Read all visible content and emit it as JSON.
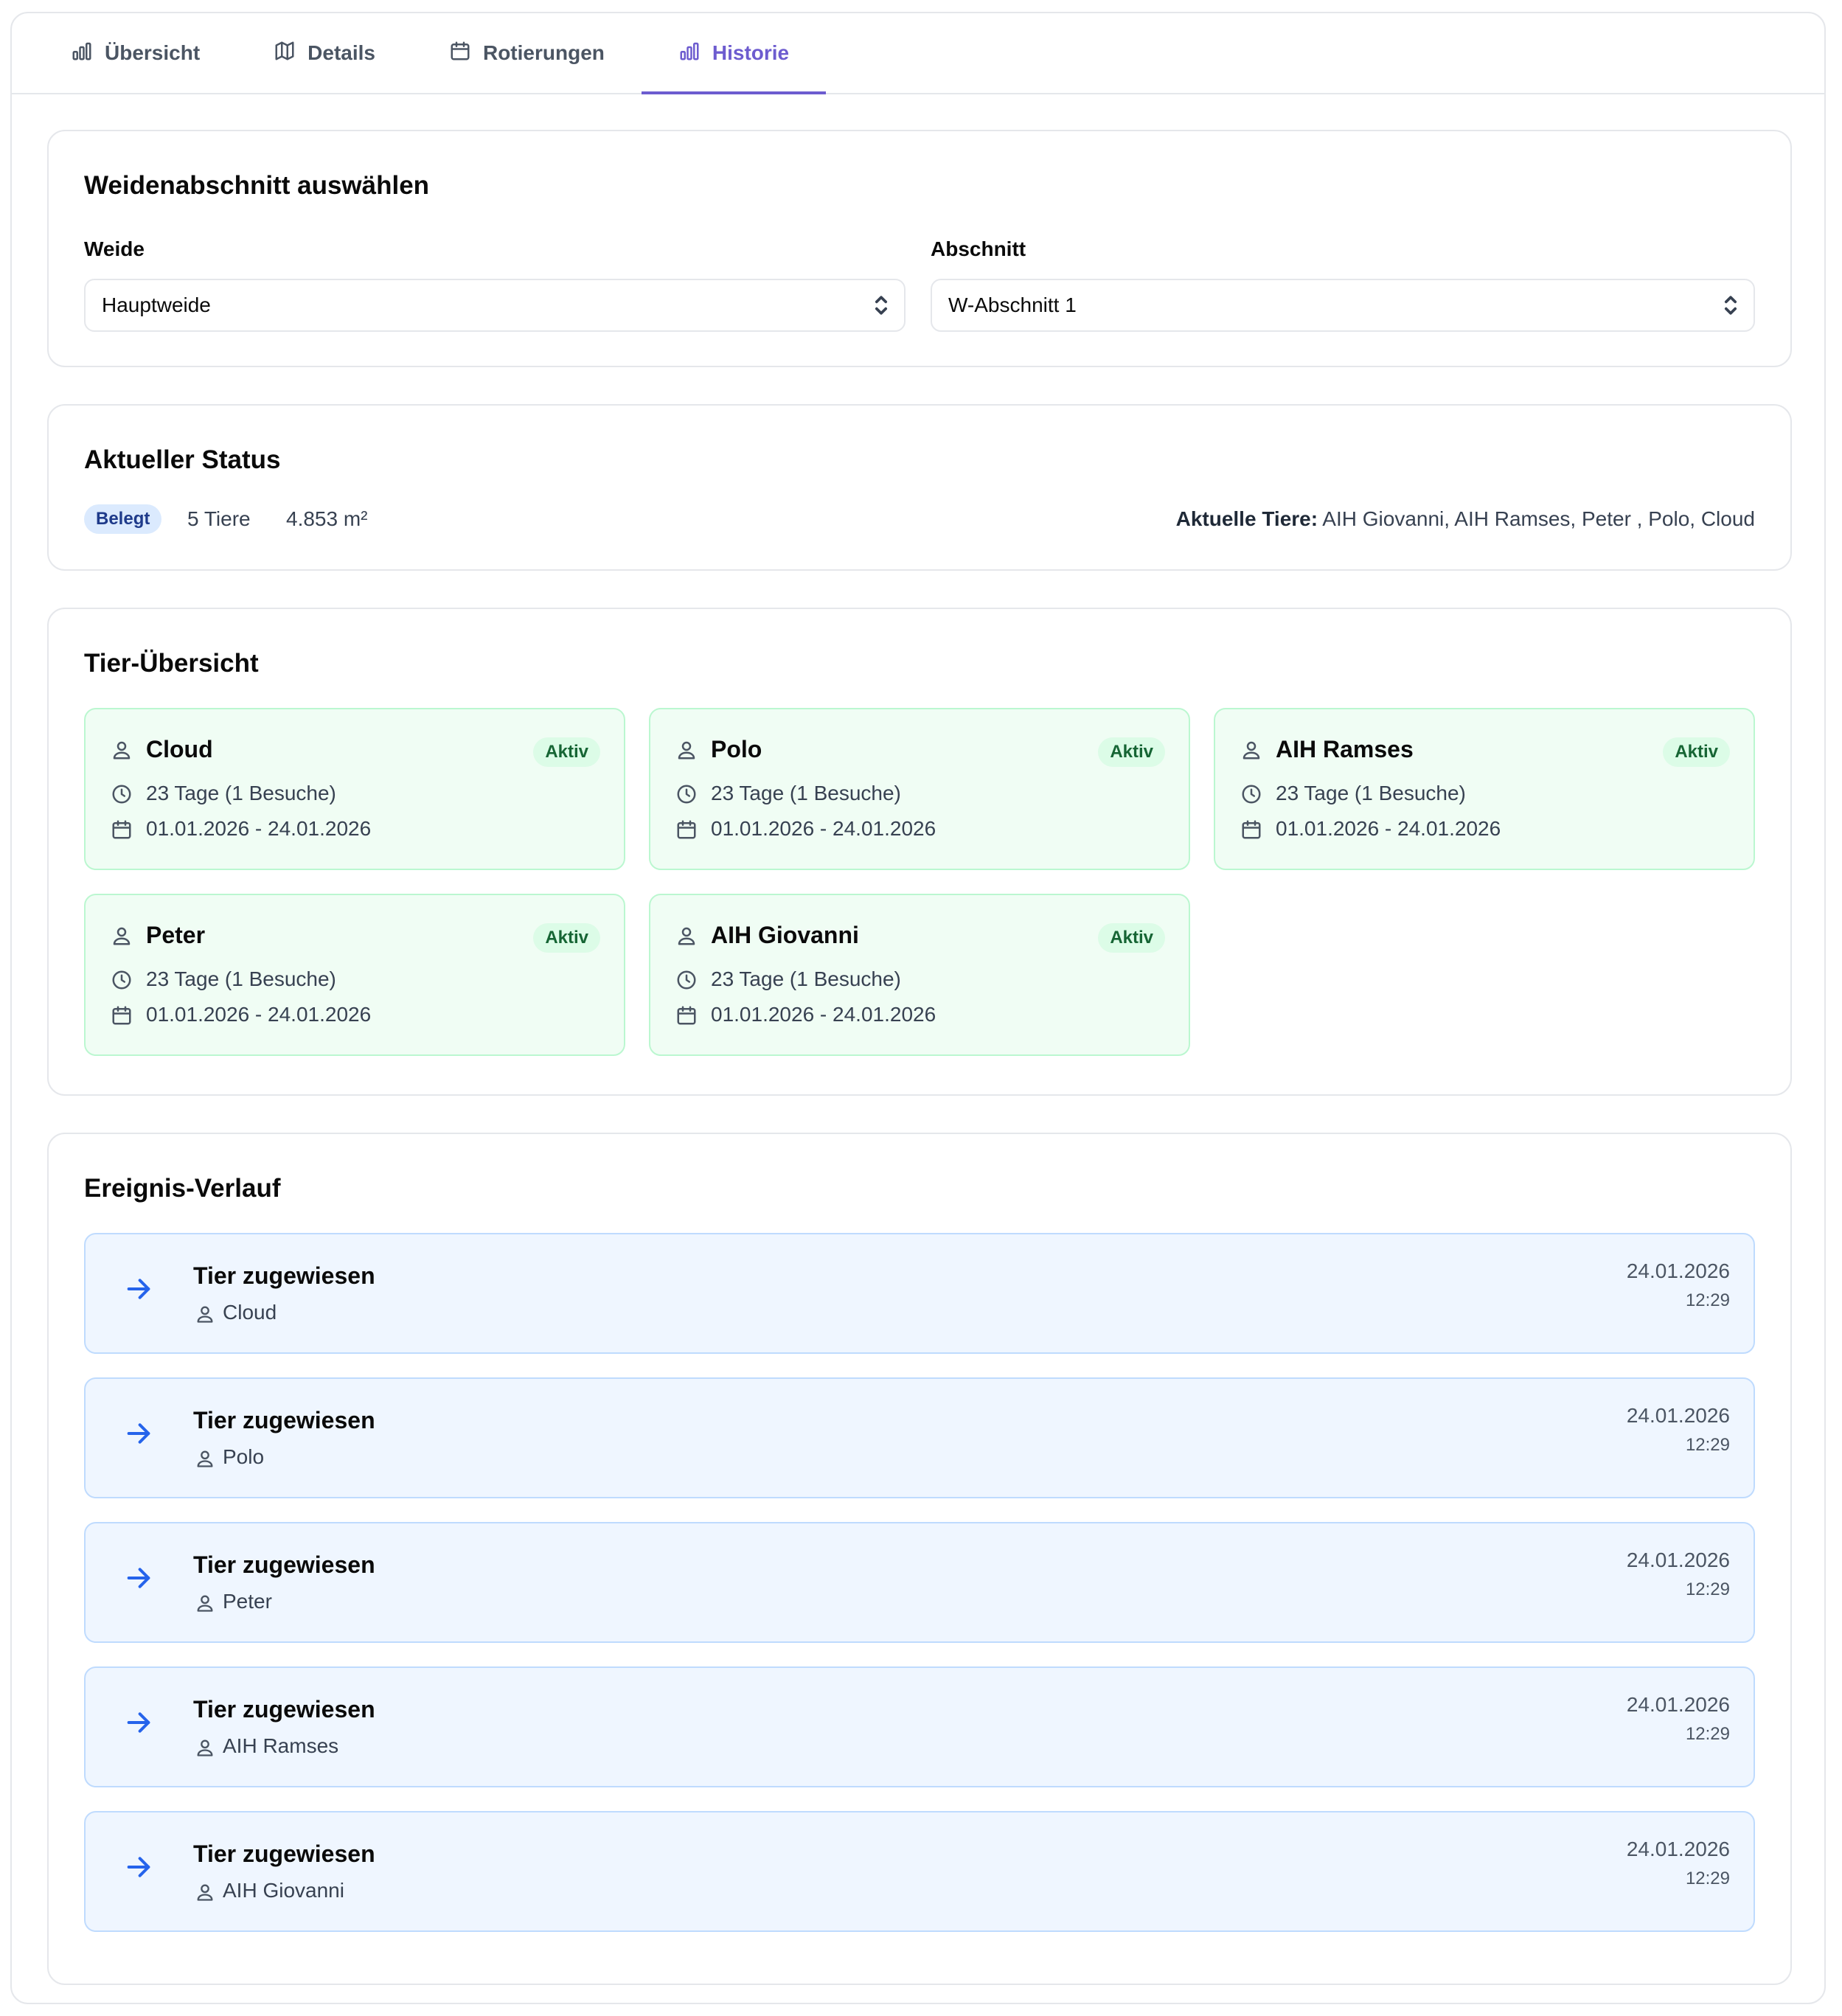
{
  "tabs": [
    {
      "label": "Übersicht",
      "icon": "bar-chart-icon",
      "active": false
    },
    {
      "label": "Details",
      "icon": "map-icon",
      "active": false
    },
    {
      "label": "Rotierungen",
      "icon": "calendar-icon",
      "active": false
    },
    {
      "label": "Historie",
      "icon": "bar-chart-icon",
      "active": true
    }
  ],
  "colors": {
    "accent": "#6d5ccf",
    "status_active_bg": "#f0fdf4",
    "event_bg": "#eff6ff"
  },
  "select_section": {
    "title": "Weidenabschnitt auswählen",
    "pasture_label": "Weide",
    "pasture_value": "Hauptweide",
    "section_label": "Abschnitt",
    "section_value": "W-Abschnitt 1"
  },
  "status": {
    "title": "Aktueller Status",
    "badge": "Belegt",
    "animals_count": "5 Tiere",
    "area": "4.853 m²",
    "current_label": "Aktuelle Tiere:",
    "current_animals": "AIH Giovanni, AIH Ramses, Peter , Polo, Cloud"
  },
  "overview": {
    "title": "Tier-Übersicht",
    "animals": [
      {
        "name": "Cloud",
        "status": "Aktiv",
        "duration": "23 Tage (1 Besuche)",
        "period": "01.01.2026 - 24.01.2026"
      },
      {
        "name": "Polo",
        "status": "Aktiv",
        "duration": "23 Tage (1 Besuche)",
        "period": "01.01.2026 - 24.01.2026"
      },
      {
        "name": "AIH Ramses",
        "status": "Aktiv",
        "duration": "23 Tage (1 Besuche)",
        "period": "01.01.2026 - 24.01.2026"
      },
      {
        "name": "Peter",
        "status": "Aktiv",
        "duration": "23 Tage (1 Besuche)",
        "period": "01.01.2026 - 24.01.2026"
      },
      {
        "name": "AIH Giovanni",
        "status": "Aktiv",
        "duration": "23 Tage (1 Besuche)",
        "period": "01.01.2026 - 24.01.2026"
      }
    ]
  },
  "events": {
    "title": "Ereignis-Verlauf",
    "items": [
      {
        "title": "Tier zugewiesen",
        "animal": "Cloud",
        "date": "24.01.2026",
        "time": "12:29"
      },
      {
        "title": "Tier zugewiesen",
        "animal": "Polo",
        "date": "24.01.2026",
        "time": "12:29"
      },
      {
        "title": "Tier zugewiesen",
        "animal": "Peter",
        "date": "24.01.2026",
        "time": "12:29"
      },
      {
        "title": "Tier zugewiesen",
        "animal": "AIH Ramses",
        "date": "24.01.2026",
        "time": "12:29"
      },
      {
        "title": "Tier zugewiesen",
        "animal": "AIH Giovanni",
        "date": "24.01.2026",
        "time": "12:29"
      }
    ]
  }
}
